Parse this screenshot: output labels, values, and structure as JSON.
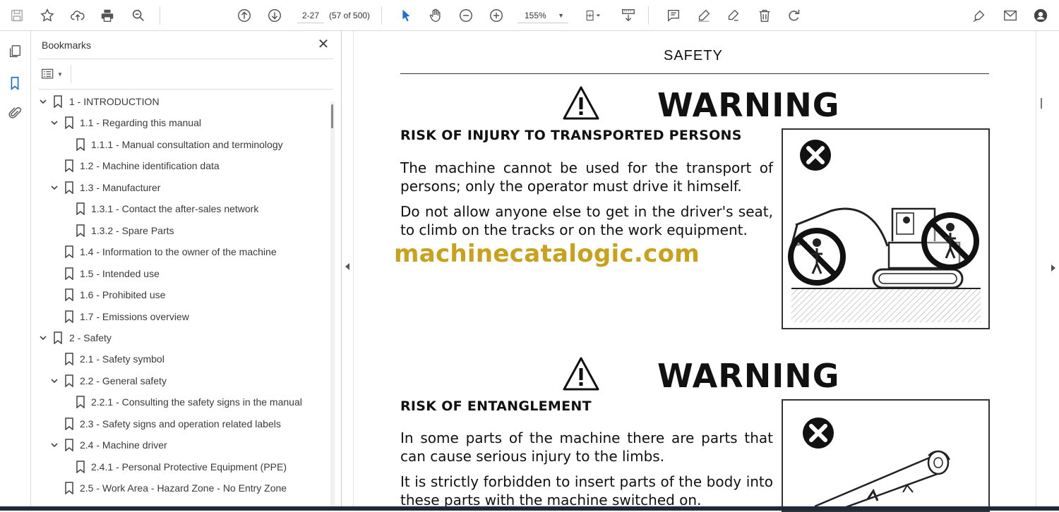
{
  "toolbar": {
    "page_current": "2-27",
    "page_count": "(57 of 500)",
    "zoom": "155%"
  },
  "bookmarks": {
    "title": "Bookmarks",
    "items": [
      {
        "label": "1  -  INTRODUCTION",
        "level": 0,
        "expanded": true
      },
      {
        "label": "1.1 - Regarding this manual",
        "level": 1,
        "expanded": true
      },
      {
        "label": "1.1.1 - Manual consultation and terminology",
        "level": 2,
        "expanded": null
      },
      {
        "label": "1.2 - Machine identification data",
        "level": 1,
        "expanded": null
      },
      {
        "label": "1.3 - Manufacturer",
        "level": 1,
        "expanded": true
      },
      {
        "label": "1.3.1 - Contact the after-sales network",
        "level": 2,
        "expanded": null
      },
      {
        "label": "1.3.2 - Spare Parts",
        "level": 2,
        "expanded": null
      },
      {
        "label": "1.4 - Information to the owner of the machine",
        "level": 1,
        "expanded": null
      },
      {
        "label": "1.5 - Intended use",
        "level": 1,
        "expanded": null
      },
      {
        "label": "1.6 - Prohibited use",
        "level": 1,
        "expanded": null
      },
      {
        "label": "1.7 - Emissions overview",
        "level": 1,
        "expanded": null
      },
      {
        "label": "2  -  Safety",
        "level": 0,
        "expanded": true
      },
      {
        "label": "2.1 - Safety symbol",
        "level": 1,
        "expanded": null
      },
      {
        "label": "2.2 - General safety",
        "level": 1,
        "expanded": true
      },
      {
        "label": "2.2.1 - Consulting the safety signs in the manual",
        "level": 2,
        "expanded": null
      },
      {
        "label": "2.3 - Safety signs and operation related labels",
        "level": 1,
        "expanded": null
      },
      {
        "label": "2.4 - Machine driver",
        "level": 1,
        "expanded": true
      },
      {
        "label": "2.4.1 - Personal Protective Equipment (PPE)",
        "level": 2,
        "expanded": null
      },
      {
        "label": "2.5 - Work Area - Hazard Zone - No Entry Zone",
        "level": 1,
        "expanded": null
      }
    ]
  },
  "document": {
    "heading": "SAFETY",
    "watermark": "machinecatalogic.com",
    "warnings": [
      {
        "word": "WARNING",
        "title": "RISK OF INJURY TO TRANSPORTED PERSONS",
        "paragraphs": [
          "The machine cannot be used for the transport of persons; only the operator must drive it himself.",
          "Do not allow anyone else to get in the driver's seat, to climb on the tracks or on the work equipment."
        ]
      },
      {
        "word": "WARNING",
        "title": "RISK OF ENTANGLEMENT",
        "paragraphs": [
          "In some parts of the machine there are parts that can cause serious injury to the limbs.",
          "It is strictly forbidden to insert parts of the body into these parts with the machine switched on."
        ]
      }
    ]
  }
}
